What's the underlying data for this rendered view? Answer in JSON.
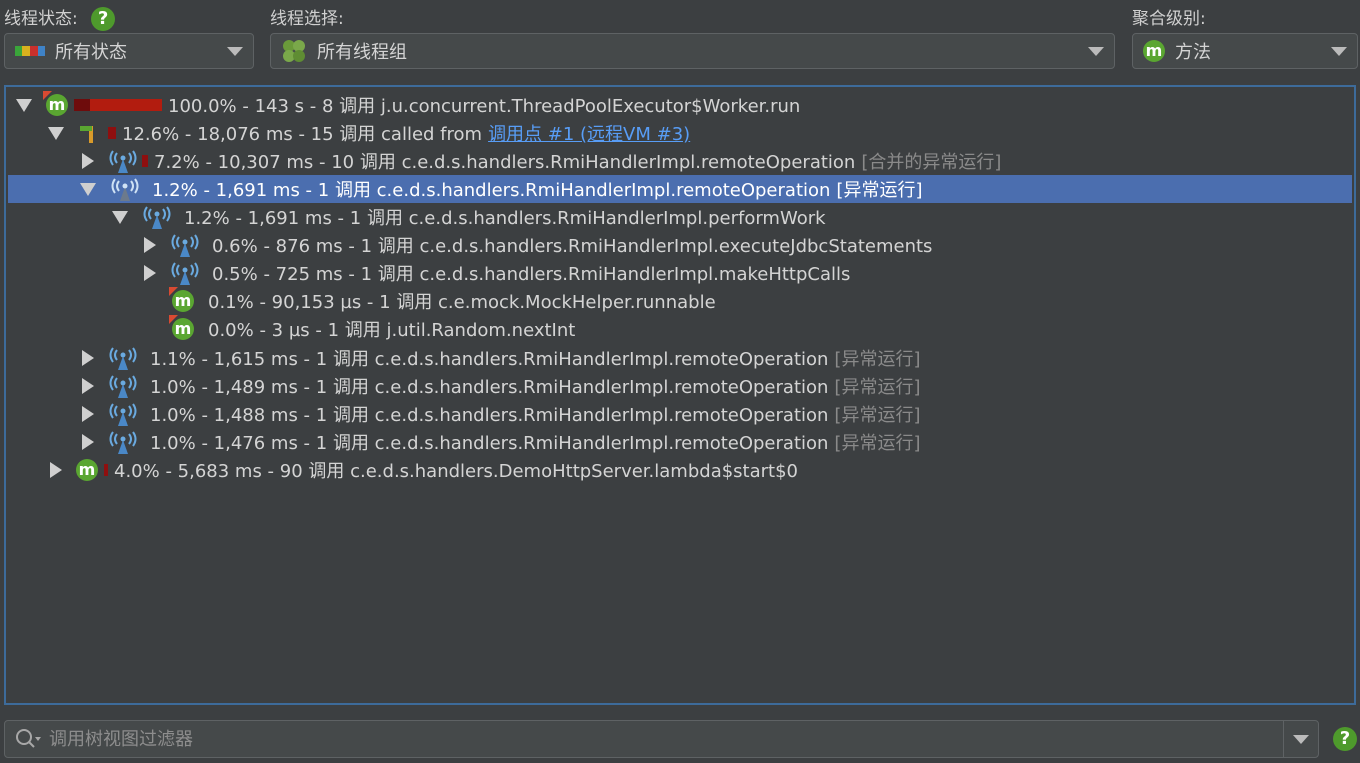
{
  "toolbar": {
    "thread_status": {
      "label": "线程状态:",
      "value": "所有状态"
    },
    "thread_select": {
      "label": "线程选择:",
      "value": "所有线程组"
    },
    "aggregation": {
      "label": "聚合级别:",
      "value": "方法"
    },
    "help_glyph": "?"
  },
  "icons": {
    "method_glyph": "m"
  },
  "tree": {
    "rows": [
      {
        "text": "100.0% - 143 s - 8 调用 j.u.concurrent.ThreadPoolExecutor$Worker.run"
      },
      {
        "text": "12.6% - 18,076 ms - 15 调用 called from ",
        "link": "调用点 #1 (远程VM #3)"
      },
      {
        "text": "7.2% - 10,307 ms - 10 调用 c.e.d.s.handlers.RmiHandlerImpl.remoteOperation ",
        "suffix": "[合并的异常运行]"
      },
      {
        "text": "1.2% - 1,691 ms - 1 调用 c.e.d.s.handlers.RmiHandlerImpl.remoteOperation ",
        "suffix": "[异常运行]"
      },
      {
        "text": "1.2% - 1,691 ms - 1 调用 c.e.d.s.handlers.RmiHandlerImpl.performWork"
      },
      {
        "text": "0.6% - 876 ms - 1 调用 c.e.d.s.handlers.RmiHandlerImpl.executeJdbcStatements"
      },
      {
        "text": "0.5% - 725 ms - 1 调用 c.e.d.s.handlers.RmiHandlerImpl.makeHttpCalls"
      },
      {
        "text": "0.1% - 90,153 µs - 1 调用 c.e.mock.MockHelper.runnable"
      },
      {
        "text": "0.0% - 3 µs - 1 调用 j.util.Random.nextInt"
      },
      {
        "text": "1.1% - 1,615 ms - 1 调用 c.e.d.s.handlers.RmiHandlerImpl.remoteOperation ",
        "suffix": "[异常运行]"
      },
      {
        "text": "1.0% - 1,489 ms - 1 调用 c.e.d.s.handlers.RmiHandlerImpl.remoteOperation ",
        "suffix": "[异常运行]"
      },
      {
        "text": "1.0% - 1,488 ms - 1 调用 c.e.d.s.handlers.RmiHandlerImpl.remoteOperation ",
        "suffix": "[异常运行]"
      },
      {
        "text": "1.0% - 1,476 ms - 1 调用 c.e.d.s.handlers.RmiHandlerImpl.remoteOperation ",
        "suffix": "[异常运行]"
      },
      {
        "text": "4.0% - 5,683 ms - 90 调用 c.e.d.s.handlers.DemoHttpServer.lambda$start$0"
      }
    ]
  },
  "filter": {
    "placeholder": "调用树视图过滤器"
  },
  "colors": {
    "selection": "#4b6eaf",
    "bar": "#b21c0f",
    "bar_dark": "#6e0c0c",
    "link": "#589df6",
    "method_icon": "#5aa631"
  }
}
